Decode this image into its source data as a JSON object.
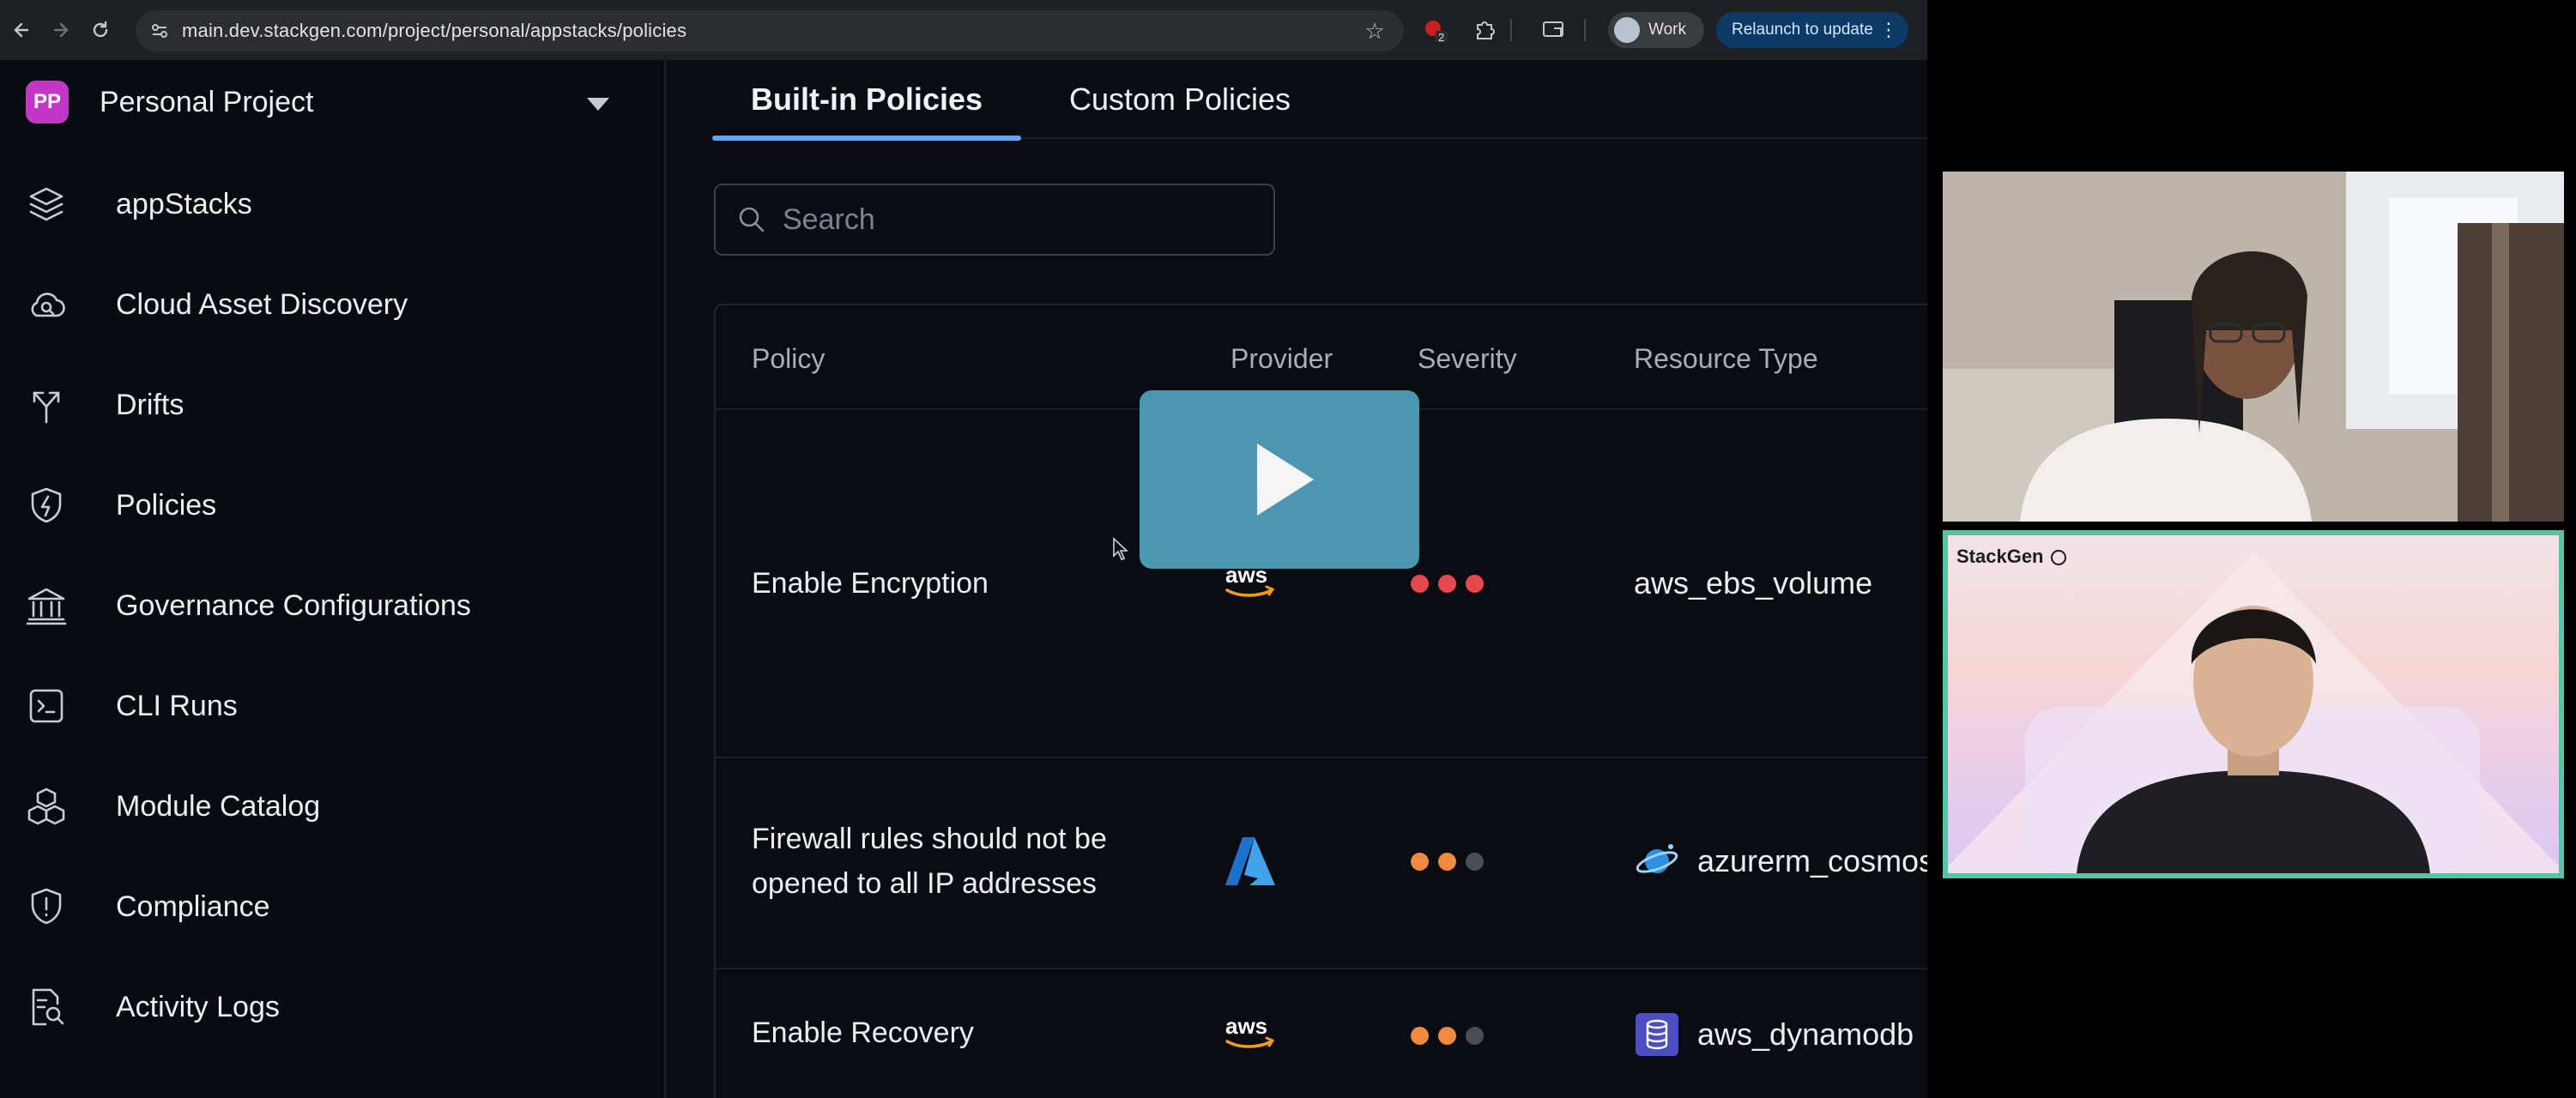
{
  "browser": {
    "url": "main.dev.stackgen.com/project/personal/appstacks/policies",
    "extension_badge": "2",
    "profile_label": "Work",
    "relaunch_label": "Relaunch to update"
  },
  "sidebar": {
    "project_badge": "PP",
    "project_name": "Personal Project",
    "items": [
      {
        "label": "appStacks",
        "icon": "layers-icon"
      },
      {
        "label": "Cloud Asset Discovery",
        "icon": "cloud-search-icon"
      },
      {
        "label": "Drifts",
        "icon": "fork-arrows-icon"
      },
      {
        "label": "Policies",
        "icon": "shield-bolt-icon"
      },
      {
        "label": "Governance Configurations",
        "icon": "bank-icon"
      },
      {
        "label": "CLI Runs",
        "icon": "terminal-icon"
      },
      {
        "label": "Module Catalog",
        "icon": "cubes-icon"
      },
      {
        "label": "Compliance",
        "icon": "shield-alert-icon"
      },
      {
        "label": "Activity Logs",
        "icon": "document-search-icon"
      }
    ]
  },
  "tabs": [
    {
      "label": "Built-in Policies",
      "active": true
    },
    {
      "label": "Custom Policies",
      "active": false
    }
  ],
  "search": {
    "placeholder": "Search"
  },
  "table": {
    "columns": [
      "Policy",
      "Provider",
      "Severity",
      "Resource Type"
    ],
    "rows": [
      {
        "policy": "Enable Encryption",
        "provider": "aws",
        "severity_colors": [
          "#e5484d",
          "#e5484d",
          "#e5484d"
        ],
        "resource": "aws_ebs_volume"
      },
      {
        "policy": "Firewall rules should not be opened to all IP addresses",
        "provider": "azure",
        "severity_colors": [
          "#f0883e",
          "#f0883e",
          "#4a4d55"
        ],
        "resource": "azurerm_cosmos"
      },
      {
        "policy": "Enable Recovery",
        "provider": "aws",
        "severity_colors": [
          "#f0883e",
          "#f0883e",
          "#4a4d55"
        ],
        "resource": "aws_dynamodb"
      }
    ]
  },
  "participants": {
    "brand_label": "StackGen"
  },
  "colors": {
    "accent": "#5aa9f2",
    "project_badge": "#c237c6",
    "play_button": "#4e9cb8",
    "active_speaker_border": "#58c3a5"
  }
}
